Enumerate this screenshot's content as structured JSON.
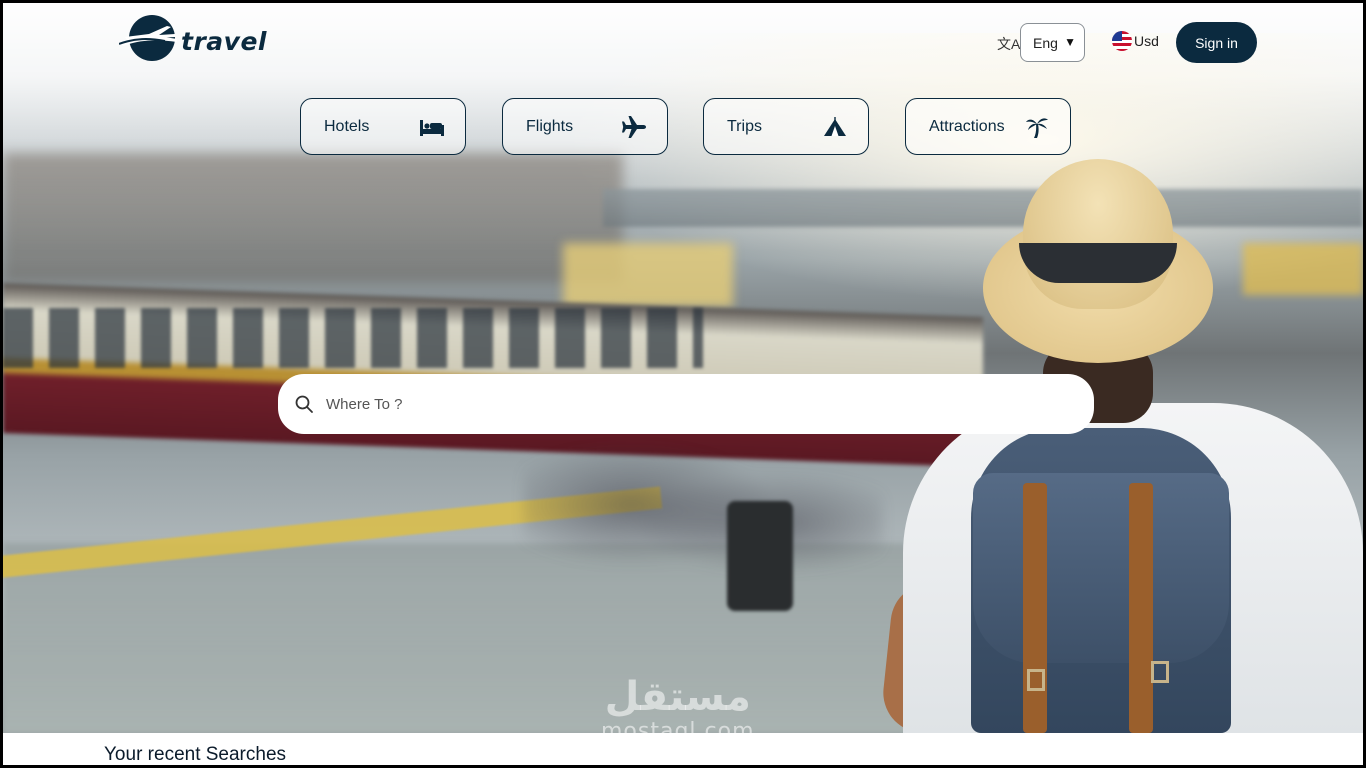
{
  "brand": {
    "name": "travel",
    "logo_icon": "plane-globe-icon",
    "color": "#0b2a3f"
  },
  "header": {
    "language_icon": "translate-icon",
    "language": {
      "selected": "Eng"
    },
    "currency": {
      "label": "Usd",
      "flag_icon": "us-flag-icon"
    },
    "signin_label": "Sign in"
  },
  "categories": [
    {
      "label": "Hotels",
      "icon": "bed-icon"
    },
    {
      "label": "Flights",
      "icon": "airplane-icon"
    },
    {
      "label": "Trips",
      "icon": "tent-icon"
    },
    {
      "label": "Attractions",
      "icon": "palm-tree-icon"
    }
  ],
  "search": {
    "placeholder": "Where To ?",
    "icon": "search-icon"
  },
  "recent": {
    "title": "Your recent Searches"
  },
  "watermark": {
    "arabic": "مستقل",
    "latin": "mostaql.com"
  }
}
